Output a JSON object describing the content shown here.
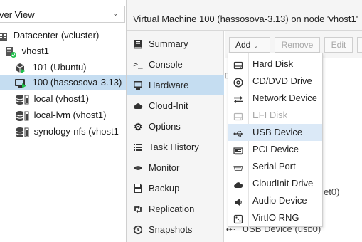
{
  "tree": {
    "view_value": "ver View",
    "items": [
      {
        "label": "Datacenter (vcluster)",
        "icon": "datacenter-icon"
      },
      {
        "label": "vhost1",
        "icon": "node-online-icon"
      },
      {
        "label": "101 (Ubuntu)",
        "icon": "container-running-icon"
      },
      {
        "label": "100 (hassosova-3.13)",
        "icon": "vm-running-icon",
        "selected": true
      },
      {
        "label": "local (vhost1)",
        "icon": "storage-icon"
      },
      {
        "label": "local-lvm (vhost1)",
        "icon": "storage-icon"
      },
      {
        "label": "synology-nfs (vhost1",
        "icon": "storage-icon"
      }
    ]
  },
  "header": {
    "title": "Virtual Machine 100 (hassosova-3.13) on node 'vhost1'"
  },
  "nav": {
    "items": [
      {
        "label": "Summary",
        "icon": "book-icon"
      },
      {
        "label": "Console",
        "icon": "terminal-icon"
      },
      {
        "label": "Hardware",
        "icon": "monitor-icon",
        "active": true
      },
      {
        "label": "Cloud-Init",
        "icon": "cloud-icon"
      },
      {
        "label": "Options",
        "icon": "gear-icon"
      },
      {
        "label": "Task History",
        "icon": "list-icon"
      },
      {
        "label": "Monitor",
        "icon": "eye-icon"
      },
      {
        "label": "Backup",
        "icon": "floppy-icon"
      },
      {
        "label": "Replication",
        "icon": "retweet-icon"
      },
      {
        "label": "Snapshots",
        "icon": "history-icon"
      }
    ]
  },
  "toolbar": {
    "add_label": "Add",
    "remove_label": "Remove",
    "edit_label": "Edit"
  },
  "content": {
    "partial_right": "et0)",
    "usb_row": "USB Device (usb0)"
  },
  "add_menu": {
    "items": [
      {
        "label": "Hard Disk",
        "icon": "hdd-icon"
      },
      {
        "label": "CD/DVD Drive",
        "icon": "cdrom-icon"
      },
      {
        "label": "Network Device",
        "icon": "network-exchange-icon"
      },
      {
        "label": "EFI Disk",
        "icon": "efi-disk-icon",
        "disabled": true
      },
      {
        "label": "USB Device",
        "icon": "usb-icon",
        "hover": true
      },
      {
        "label": "PCI Device",
        "icon": "pci-card-icon"
      },
      {
        "label": "Serial Port",
        "icon": "serial-port-icon"
      },
      {
        "label": "CloudInit Drive",
        "icon": "cloud-icon"
      },
      {
        "label": "Audio Device",
        "icon": "audio-icon"
      },
      {
        "label": "VirtIO RNG",
        "icon": "dice-icon"
      }
    ]
  },
  "colors": {
    "selection": "#c5ddf1",
    "menu_hover": "#dbe9f7",
    "running_green": "#21bf4b",
    "panel_bg": "#f5f5f5"
  }
}
